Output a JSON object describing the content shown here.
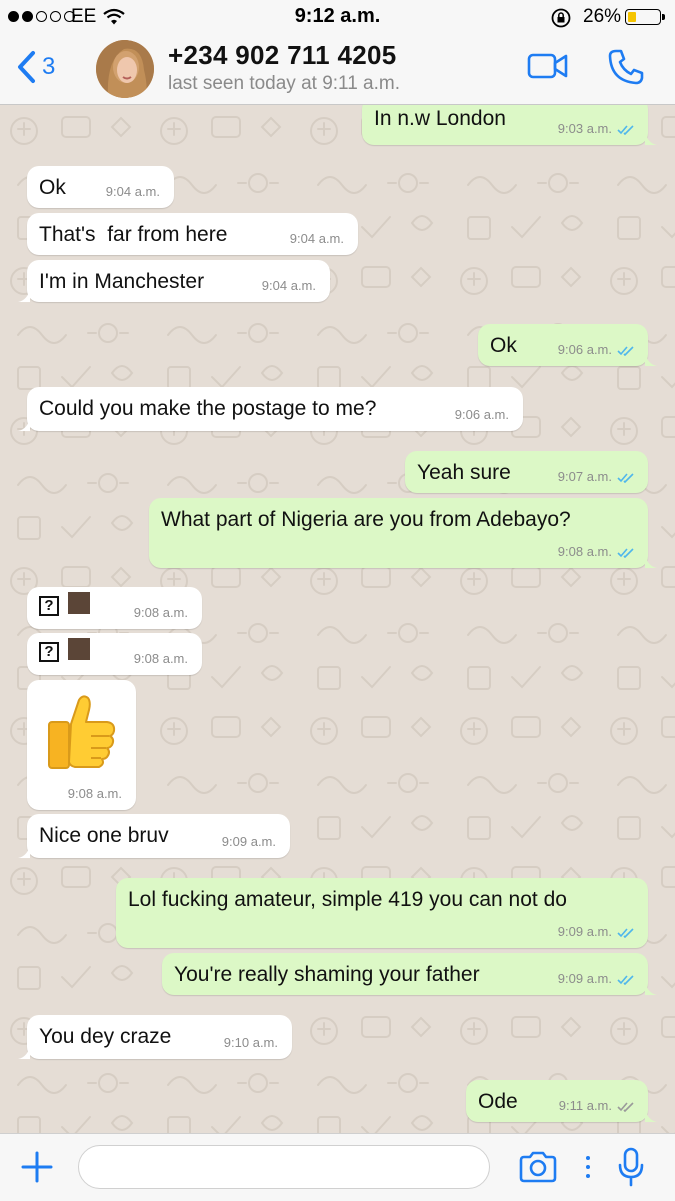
{
  "status": {
    "carrier": "EE",
    "time": "9:12 a.m.",
    "battery": "26%",
    "battery_level": 0.26,
    "signal_bars_filled": 2,
    "signal_bars_total": 5
  },
  "header": {
    "back_count": "3",
    "contact_name": "+234 902 711 4205",
    "contact_status": "last seen today at 9:11 a.m."
  },
  "messages": [
    {
      "dir": "out",
      "text": "In n.w London",
      "time": "9:03 a.m.",
      "ticks": "read"
    },
    {
      "dir": "in",
      "text": "Ok",
      "time": "9:04 a.m."
    },
    {
      "dir": "in",
      "text": "That's  far from here",
      "time": "9:04 a.m."
    },
    {
      "dir": "in",
      "text": "I'm in Manchester",
      "time": "9:04 a.m."
    },
    {
      "dir": "out",
      "text": "Ok",
      "time": "9:06 a.m.",
      "ticks": "read"
    },
    {
      "dir": "in",
      "text": "Could you make the postage to me?",
      "time": "9:06 a.m."
    },
    {
      "dir": "out",
      "text": "Yeah sure",
      "time": "9:07 a.m.",
      "ticks": "read"
    },
    {
      "dir": "out",
      "text": "What part of Nigeria are you from Adebayo?",
      "time": "9:08 a.m.",
      "ticks": "read"
    },
    {
      "dir": "in",
      "text": "?",
      "time": "9:08 a.m.",
      "kind": "unsupported-emoji"
    },
    {
      "dir": "in",
      "text": "?",
      "time": "9:08 a.m.",
      "kind": "unsupported-emoji"
    },
    {
      "dir": "in",
      "text": "",
      "time": "9:08 a.m.",
      "kind": "thumbs-up-sticker"
    },
    {
      "dir": "in",
      "text": "Nice one bruv",
      "time": "9:09 a.m."
    },
    {
      "dir": "out",
      "text": "Lol fucking amateur, simple 419 you can not do",
      "time": "9:09 a.m.",
      "ticks": "read"
    },
    {
      "dir": "out",
      "text": "You're really shaming your father",
      "time": "9:09 a.m.",
      "ticks": "read"
    },
    {
      "dir": "in",
      "text": "You dey craze",
      "time": "9:10 a.m."
    },
    {
      "dir": "out",
      "text": "Ode",
      "time": "9:11 a.m.",
      "ticks": "delivered"
    }
  ],
  "input": {
    "placeholder": ""
  },
  "colors": {
    "accent": "#1e7cf2",
    "outgoing_bubble": "#dcf8c6",
    "incoming_bubble": "#ffffff",
    "chat_background": "#e5ddd5",
    "read_ticks": "#4fb6ec",
    "delivered_ticks": "#9a9a9a"
  },
  "icons": {
    "back": "chevron-left-icon",
    "video": "video-camera-icon",
    "call": "phone-icon",
    "attach": "plus-icon",
    "camera": "camera-icon",
    "mic": "microphone-icon"
  }
}
